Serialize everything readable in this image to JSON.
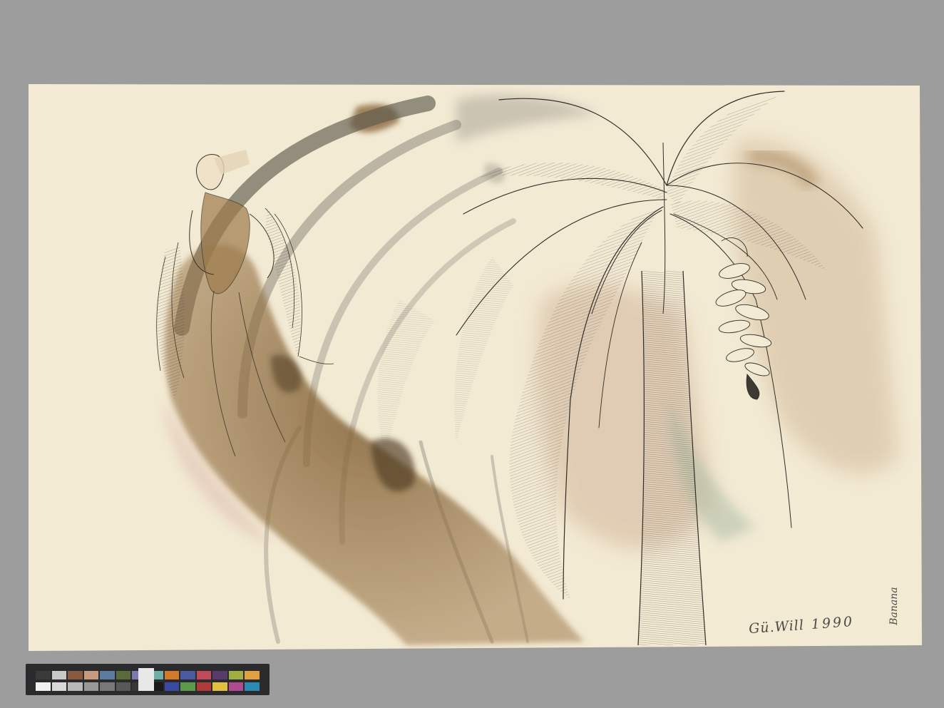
{
  "artwork": {
    "signature": "Gü.Will",
    "year": "1990",
    "inscription": "Banana"
  },
  "colors": {
    "wall": "#9d9d9d",
    "paper": "#f3ead4",
    "ink": "#2f2d28",
    "sepia_wash": "#8b6b3f",
    "grey_wash": "#8d8a7f",
    "green_wash": "#a7b8a0",
    "rose_wash": "#d9b5a8"
  },
  "color_checker": {
    "patches": [
      "#3a3a3a",
      "#c8c8c8",
      "#8a5a3c",
      "#c69a7c",
      "#5b7ba0",
      "#5a6a3a",
      "#7a7ab0",
      "#6cb0a8",
      "#d07a2a",
      "#4a5aa0",
      "#c04a5a",
      "#5a3a6a",
      "#a0b040",
      "#e0a040",
      "#f0f0f0",
      "#d8d8d8",
      "#b8b8b8",
      "#989898",
      "#787878",
      "#585858",
      "#383838",
      "#1a1a1a",
      "#3a4aa0",
      "#5a9a4a",
      "#b03a3a",
      "#e0c040",
      "#b04a90",
      "#2a8ab0"
    ]
  }
}
